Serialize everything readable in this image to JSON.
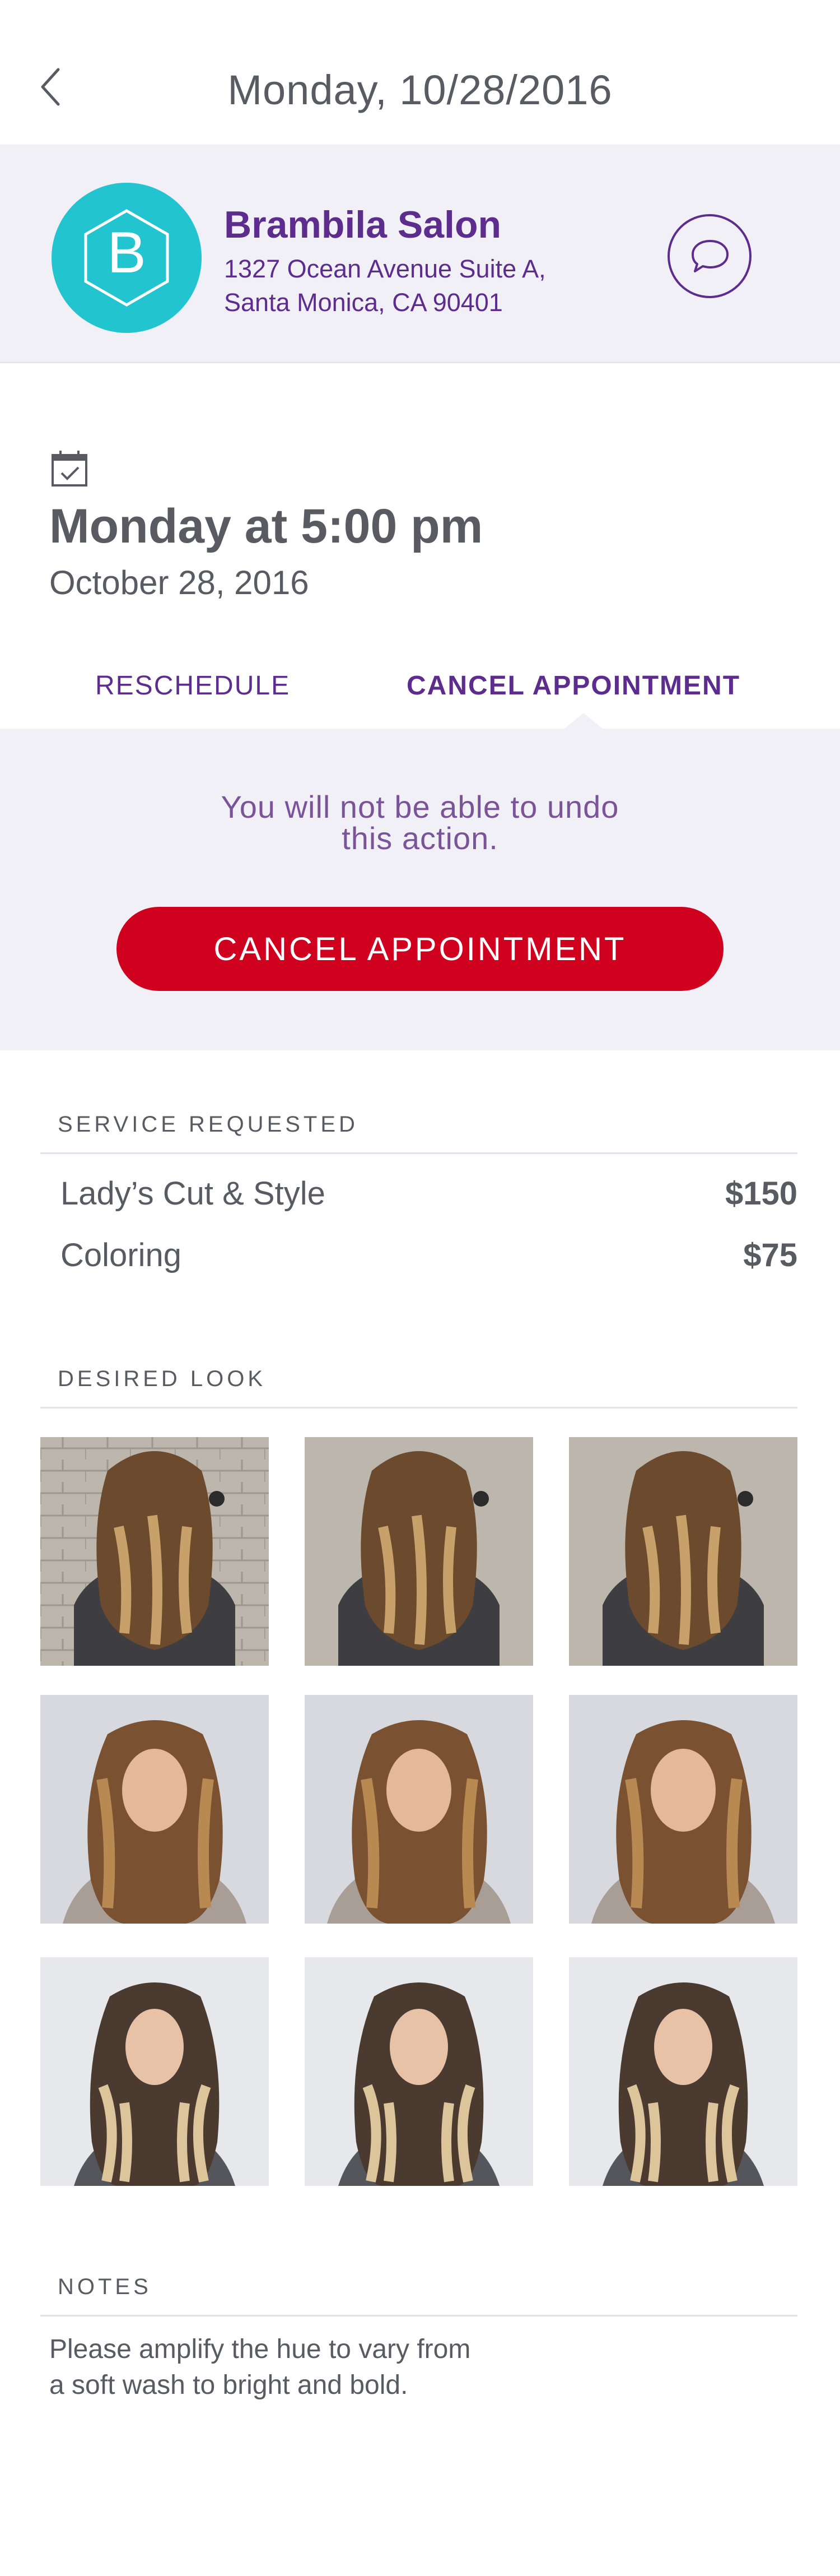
{
  "header": {
    "title": "Monday, 10/28/2016",
    "back_icon": "chevron-left-icon"
  },
  "salon": {
    "logo_letter": "B",
    "name": "Brambila Salon",
    "address_line1": "1327 Ocean Avenue Suite A,",
    "address_line2": "Santa Monica, CA 90401",
    "chat_icon": "chat-bubble-icon",
    "colors": {
      "brand": "#5d2d8e",
      "logo_bg": "#21c4cf",
      "band_bg": "#f1f0f7"
    }
  },
  "appointment": {
    "icon": "calendar-check-icon",
    "title": "Monday at 5:00 pm",
    "date": "October 28, 2016"
  },
  "tabs": [
    {
      "label": "RESCHEDULE",
      "selected": false
    },
    {
      "label": "CANCEL APPOINTMENT",
      "selected": true
    }
  ],
  "cancel_panel": {
    "warning_line1": "You will not be able to undo",
    "warning_line2": "this action.",
    "button_label": "CANCEL APPOINTMENT",
    "button_color": "#d0001f"
  },
  "services": {
    "heading": "SERVICE REQUESTED",
    "items": [
      {
        "name": "Lady’s Cut & Style",
        "price": "$150"
      },
      {
        "name": "Coloring",
        "price": "$75"
      }
    ]
  },
  "desired_look": {
    "heading": "DESIRED LOOK",
    "rows": [
      {
        "style": "back-view-wavy-balayage",
        "count": 3
      },
      {
        "style": "portrait-long-wavy-brown",
        "count": 3
      },
      {
        "style": "portrait-long-wavy-blonde-ombre",
        "count": 3
      }
    ]
  },
  "notes": {
    "heading": "NOTES",
    "line1": "Please amplify the hue to vary from",
    "line2": "a soft wash to bright and bold."
  }
}
